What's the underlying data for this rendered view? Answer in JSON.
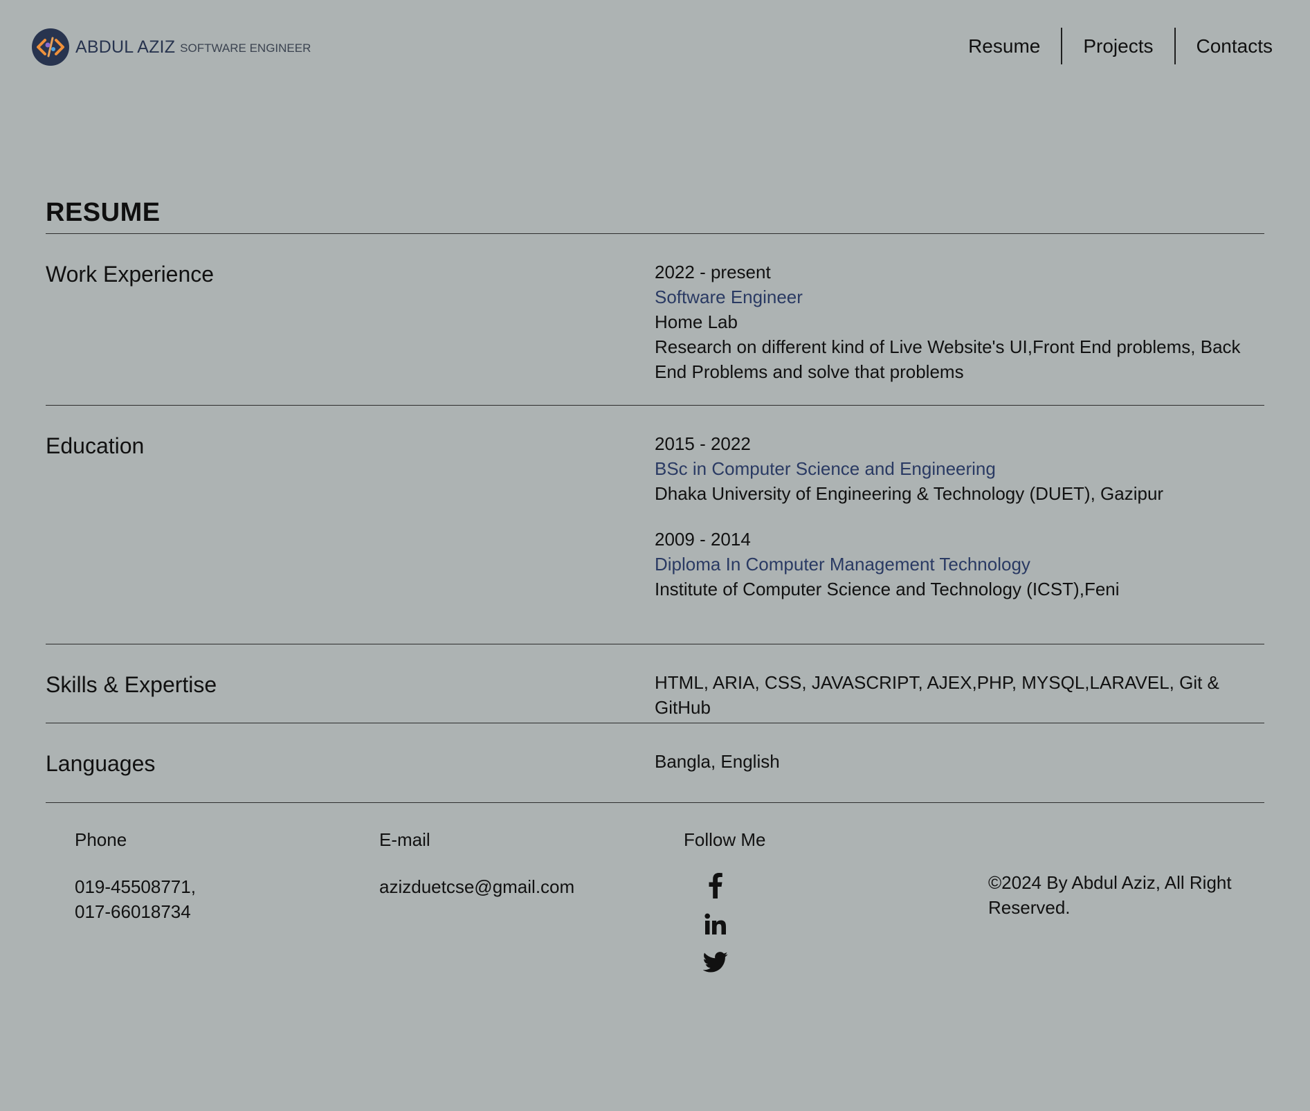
{
  "header": {
    "brand_name": "ABDUL AZIZ",
    "brand_subtitle": "SOFTWARE ENGINEER",
    "logo_icon": "code-brackets-logo-icon",
    "nav": [
      {
        "label": "Resume"
      },
      {
        "label": "Projects"
      },
      {
        "label": "Contacts"
      }
    ]
  },
  "resume": {
    "title": "RESUME",
    "work": {
      "label": "Work Experience",
      "period": "2022 - present",
      "role": "Software Engineer",
      "company": "Home Lab",
      "description": "Research on different kind of Live Website's UI,Front End problems, Back End Problems and solve that problems"
    },
    "education": {
      "label": "Education",
      "items": [
        {
          "period": "2015 - 2022",
          "degree": "BSc in Computer Science and Engineering",
          "institution": "Dhaka University of Engineering & Technology (DUET), Gazipur"
        },
        {
          "period": "2009 - 2014",
          "degree": "Diploma In Computer Management Technology",
          "institution": "Institute of Computer Science and Technology (ICST),Feni"
        }
      ]
    },
    "skills": {
      "label": "Skills & Expertise",
      "value": "HTML, ARIA, CSS, JAVASCRIPT, AJEX,PHP, MYSQL,LARAVEL, Git & GitHub"
    },
    "languages": {
      "label": "Languages",
      "value": "Bangla, English"
    }
  },
  "footer": {
    "phone_label": "Phone",
    "phone_line1": "019-45508771,",
    "phone_line2": "017-66018734",
    "email_label": "E-mail",
    "email": "azizduetcse@gmail.com",
    "follow_label": "Follow Me",
    "social_icons": [
      "facebook-icon",
      "linkedin-icon",
      "twitter-icon"
    ],
    "copyright": "©2024 By Abdul Aziz, All Right Reserved."
  },
  "colors": {
    "background": "#adb3b3",
    "accent": "#2a3a63",
    "logo_bg": "#28344f",
    "logo_orange": "#f0913a"
  }
}
